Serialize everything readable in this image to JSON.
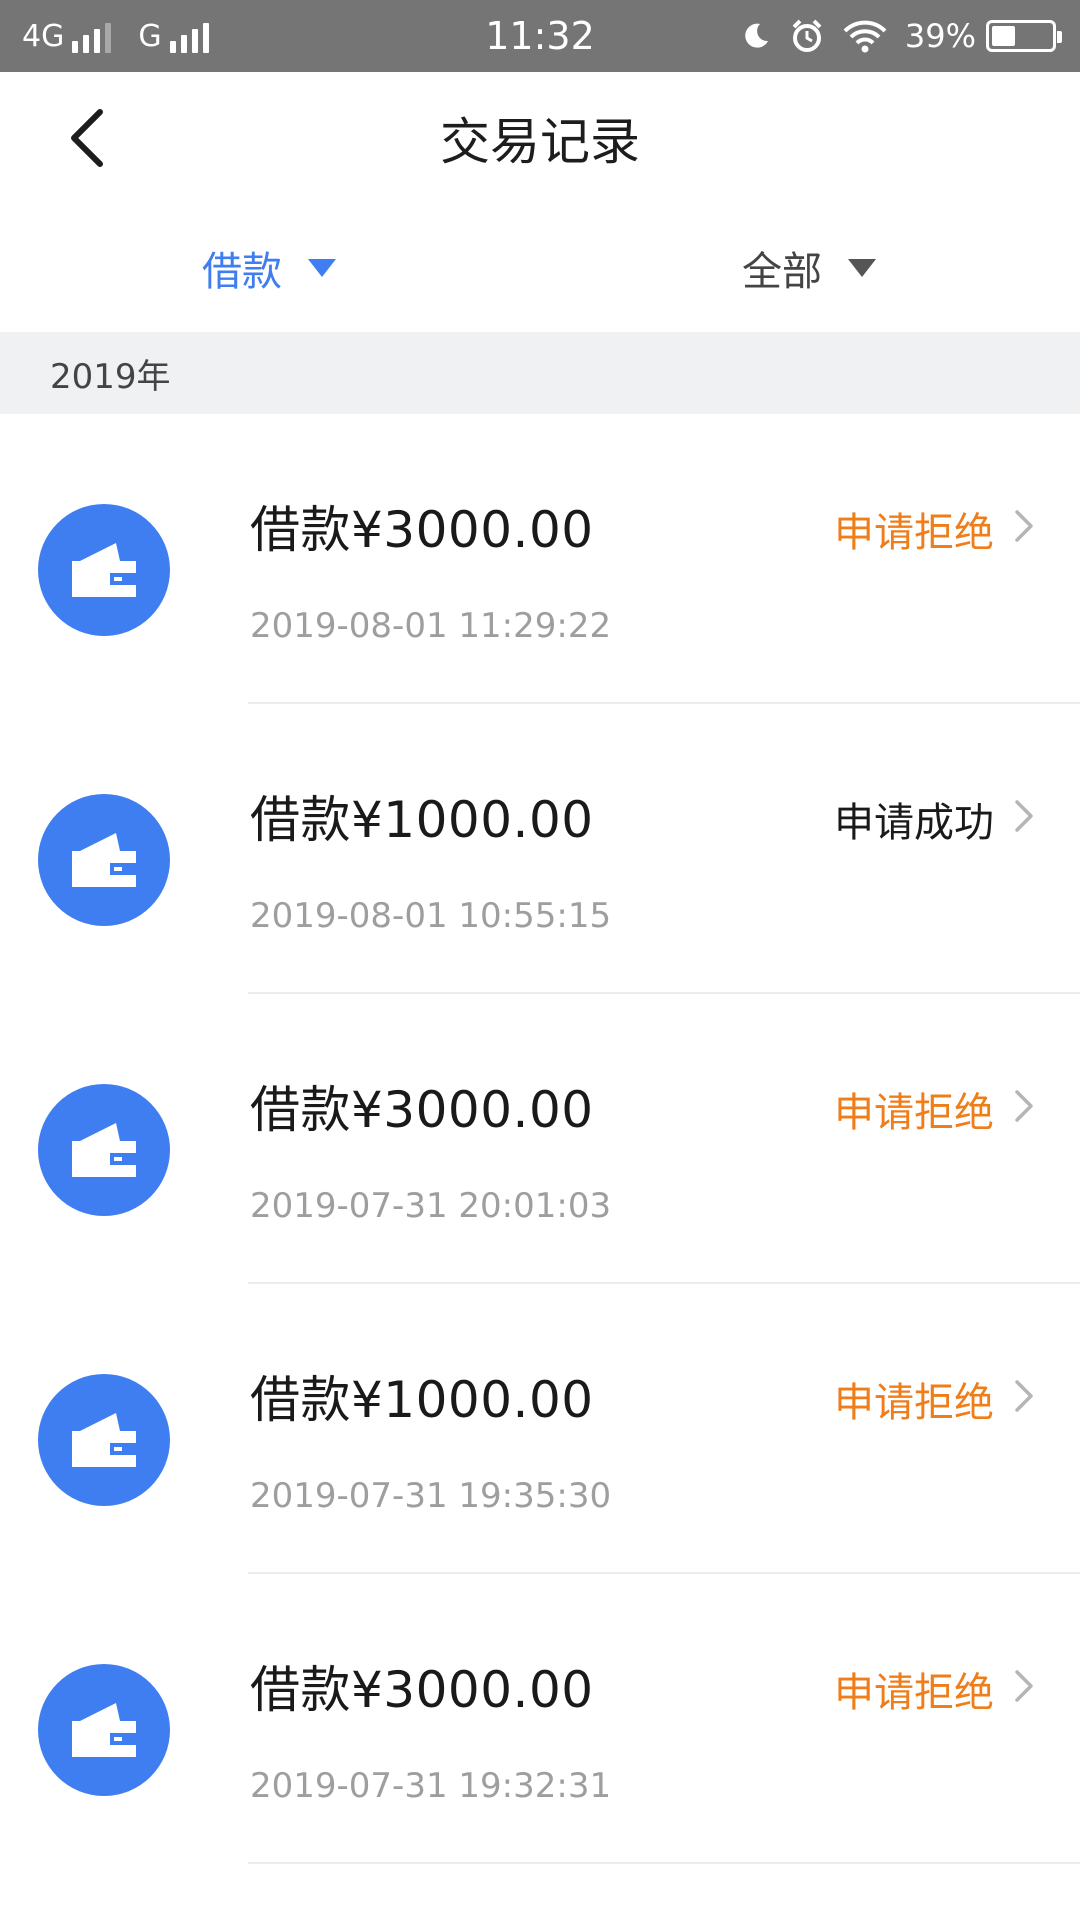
{
  "status_bar": {
    "net1": "4G",
    "net2": "G",
    "time": "11:32",
    "battery": "39%",
    "battery_level": 0.39
  },
  "header": {
    "title": "交易记录"
  },
  "filters": {
    "type_label": "借款",
    "status_label": "全部"
  },
  "section": {
    "year": "2019年"
  },
  "colors": {
    "accent_blue": "#3f7ef0",
    "rejected_orange": "#ef7d1a",
    "success_text": "#1a1a1a"
  },
  "records": [
    {
      "amount": "借款¥3000.00",
      "time": "2019-08-01 11:29:22",
      "status": "申请拒绝",
      "status_color": "#ef7d1a"
    },
    {
      "amount": "借款¥1000.00",
      "time": "2019-08-01 10:55:15",
      "status": "申请成功",
      "status_color": "#1a1a1a"
    },
    {
      "amount": "借款¥3000.00",
      "time": "2019-07-31 20:01:03",
      "status": "申请拒绝",
      "status_color": "#ef7d1a"
    },
    {
      "amount": "借款¥1000.00",
      "time": "2019-07-31 19:35:30",
      "status": "申请拒绝",
      "status_color": "#ef7d1a"
    },
    {
      "amount": "借款¥3000.00",
      "time": "2019-07-31 19:32:31",
      "status": "申请拒绝",
      "status_color": "#ef7d1a"
    }
  ]
}
